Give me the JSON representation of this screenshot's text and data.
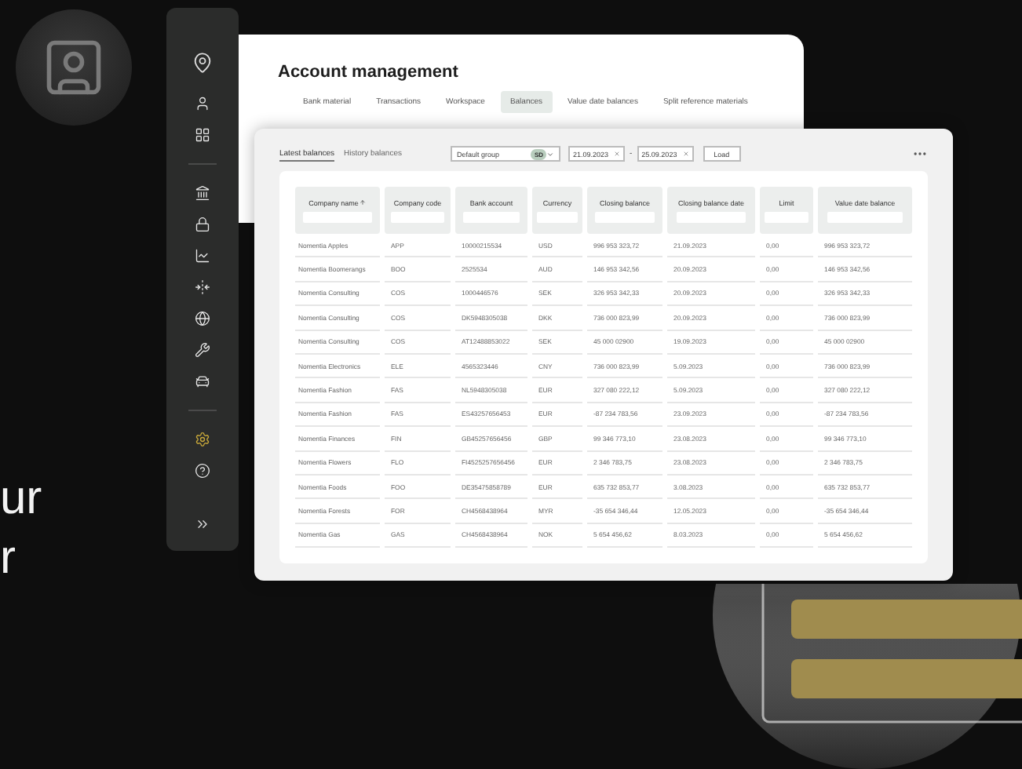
{
  "hero_text": [
    "ur",
    "r"
  ],
  "sidebar": {
    "items": [
      {
        "kind": "logo"
      },
      {
        "kind": "user"
      },
      {
        "kind": "grid"
      },
      {
        "kind": "divider"
      },
      {
        "kind": "bank"
      },
      {
        "kind": "lock"
      },
      {
        "kind": "chart"
      },
      {
        "kind": "merge"
      },
      {
        "kind": "globe"
      },
      {
        "kind": "wrench"
      },
      {
        "kind": "car"
      },
      {
        "kind": "divider"
      },
      {
        "kind": "settings"
      },
      {
        "kind": "help"
      },
      {
        "kind": "expand"
      }
    ]
  },
  "window": {
    "title": "Account management"
  },
  "tabs": [
    {
      "label": "Bank material",
      "selected": false
    },
    {
      "label": "Transactions",
      "selected": false
    },
    {
      "label": "Workspace",
      "selected": false
    },
    {
      "label": "Balances",
      "selected": true
    },
    {
      "label": "Value date balances",
      "selected": false
    },
    {
      "label": "Split reference materials",
      "selected": false
    }
  ],
  "subtabs": [
    {
      "label": "Latest balances",
      "selected": true
    },
    {
      "label": "History balances",
      "selected": false
    }
  ],
  "group_select": {
    "value": "Default group",
    "badge": "SD"
  },
  "date_from": {
    "value": "21.09.2023"
  },
  "date_separator": "-",
  "date_to": {
    "value": "25.09.2023"
  },
  "load_button": "Load",
  "table": {
    "columns": [
      {
        "label": "Company name",
        "sorted": true
      },
      {
        "label": "Company code",
        "sorted": false
      },
      {
        "label": "Bank account",
        "sorted": false
      },
      {
        "label": "Currency",
        "sorted": false
      },
      {
        "label": "Closing balance",
        "sorted": false
      },
      {
        "label": "Closing balance date",
        "sorted": false
      },
      {
        "label": "Limit",
        "sorted": false
      },
      {
        "label": "Value date balance",
        "sorted": false
      }
    ],
    "rows": [
      [
        "Nomentia Apples",
        "APP",
        "10000215534",
        "USD",
        "996 953 323,72",
        "21.09.2023",
        "0,00",
        "996 953 323,72"
      ],
      [
        "Nomentia Boomerangs",
        "BOO",
        "2525534",
        "AUD",
        "146 953 342,56",
        "20.09.2023",
        "0,00",
        "146 953 342,56"
      ],
      [
        "Nomentia Consulting",
        "COS",
        "1000446576",
        "SEK",
        "326 953 342,33",
        "20.09.2023",
        "0,00",
        "326 953 342,33"
      ],
      [
        "Nomentia Consulting",
        "COS",
        "DK5948305038",
        "DKK",
        "736 000 823,99",
        "20.09.2023",
        "0,00",
        "736 000 823,99"
      ],
      [
        "Nomentia Consulting",
        "COS",
        "AT12488853022",
        "SEK",
        "45 000 02900",
        "19.09.2023",
        "0,00",
        "45 000 02900"
      ],
      [
        "Nomentia Electronics",
        "ELE",
        "4565323446",
        "CNY",
        "736 000 823,99",
        "5.09.2023",
        "0,00",
        "736 000 823,99"
      ],
      [
        "Nomentia Fashion",
        "FAS",
        "NL5948305038",
        "EUR",
        "327 080 222,12",
        "5.09.2023",
        "0,00",
        "327 080 222,12"
      ],
      [
        "Nomentia Fashion",
        "FAS",
        "ES43257656453",
        "EUR",
        "-87 234 783,56",
        "23.09.2023",
        "0,00",
        "-87 234 783,56"
      ],
      [
        "Nomentia Finances",
        "FIN",
        "GB45257656456",
        "GBP",
        "99 346 773,10",
        "23.08.2023",
        "0,00",
        "99 346 773,10"
      ],
      [
        "Nomentia Flowers",
        "FLO",
        "FI4525257656456",
        "EUR",
        "2 346 783,75",
        "23.08.2023",
        "0,00",
        "2 346 783,75"
      ],
      [
        "Nomentia Foods",
        "FOO",
        "DE35475858789",
        "EUR",
        "635 732 853,77",
        "3.08.2023",
        "0,00",
        "635 732 853,77"
      ],
      [
        "Nomentia Forests",
        "FOR",
        "CH4568438964",
        "MYR",
        "-35 654 346,44",
        "12.05.2023",
        "0,00",
        "-35 654 346,44"
      ],
      [
        "Nomentia Gas",
        "GAS",
        "CH4568438964",
        "NOK",
        "5 654 456,62",
        "8.03.2023",
        "0,00",
        "5 654 456,62"
      ]
    ]
  }
}
